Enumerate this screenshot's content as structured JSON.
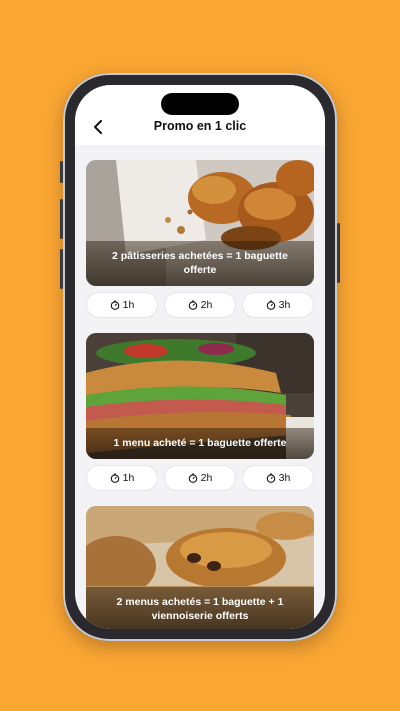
{
  "header": {
    "title": "Promo en 1 clic",
    "back_icon": "chevron-left-icon"
  },
  "promos": [
    {
      "caption": "2 pâtisseries achetées = 1 baguette offerte",
      "image": "croissants-photo",
      "durations": [
        "1h",
        "2h",
        "3h"
      ]
    },
    {
      "caption": "1 menu acheté = 1 baguette offerte",
      "image": "sandwich-photo",
      "durations": [
        "1h",
        "2h",
        "3h"
      ]
    },
    {
      "caption": "2 menus achetés = 1 baguette + 1 viennoiserie offerts",
      "image": "pain-au-chocolat-photo"
    }
  ],
  "colors": {
    "background": "#FAA633",
    "screen": "#F3F3F6"
  }
}
